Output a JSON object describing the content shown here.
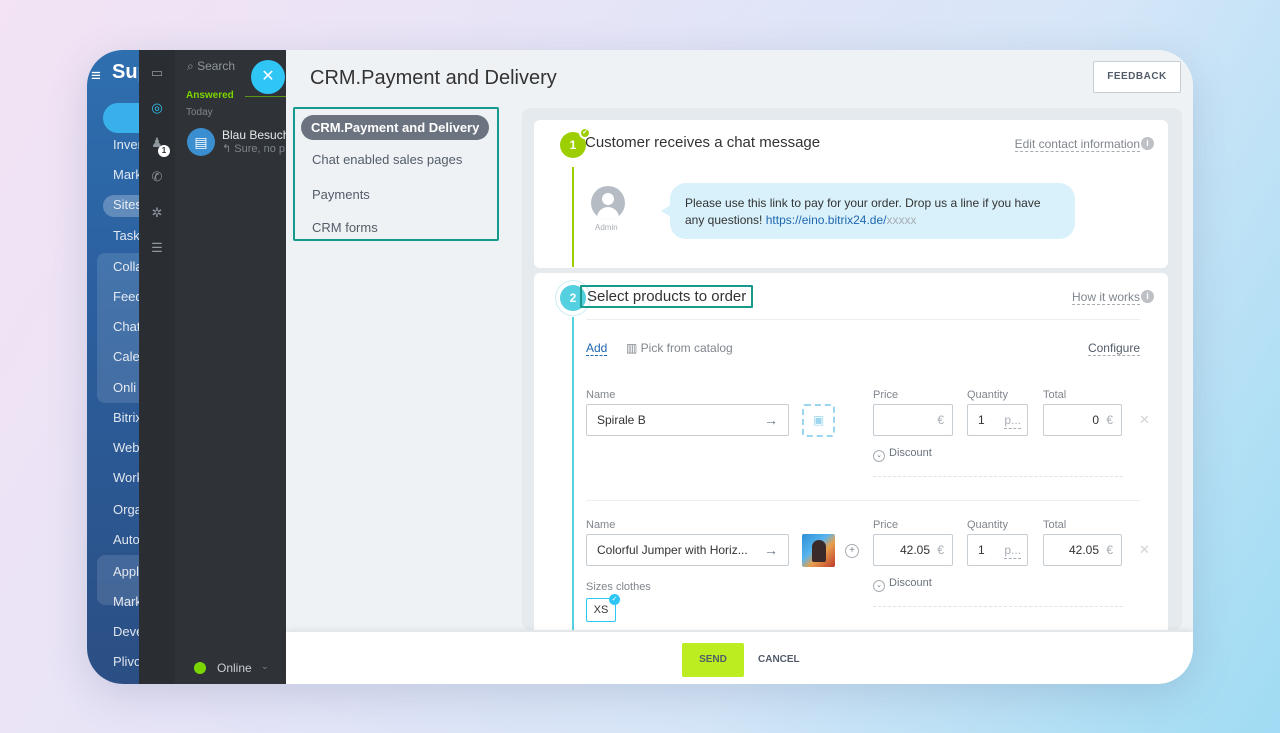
{
  "portal": {
    "logo": "Sup",
    "items": [
      "Inven",
      "Mark",
      "Sites",
      "Task",
      "Colla",
      "Feed",
      "Chat",
      "Cale",
      "Onli",
      "Bitrix",
      "Web",
      "Work",
      "Orga",
      "Auto",
      "Appl",
      "Mark",
      "Deve",
      "Plivo"
    ]
  },
  "chatlist": {
    "search_placeholder": "Search",
    "answered": "Answered",
    "today": "Today",
    "chat_name": "Blau Besuch",
    "chat_preview": "Sure, no p",
    "status": "Online"
  },
  "panel": {
    "title": "CRM.Payment and Delivery",
    "feedback": "FEEDBACK",
    "menu": [
      {
        "label": "CRM.Payment and Delivery",
        "active": true
      },
      {
        "label": "Chat enabled sales pages",
        "active": false
      },
      {
        "label": "Payments",
        "active": false
      },
      {
        "label": "CRM forms",
        "active": false
      }
    ]
  },
  "step1": {
    "number": "1",
    "title": "Customer receives a chat message",
    "link": "Edit contact information",
    "avatar_label": "Admin",
    "message": "Please use this link to pay for your order. Drop us a line if you have any questions!",
    "message_link": "https://eino.bitrix24.de/",
    "message_link_mask": "xxxxx"
  },
  "step2": {
    "number": "2",
    "title": "Select products to order",
    "link": "How it works",
    "add": "Add",
    "catalog": "Pick from catalog",
    "configure": "Configure",
    "labels": {
      "name": "Name",
      "price": "Price",
      "quantity": "Quantity",
      "total": "Total"
    },
    "discount_label": "Discount",
    "products": [
      {
        "name": "Spirale B",
        "price": "",
        "currency": "€",
        "quantity": "1",
        "unit": "p...",
        "total": "0"
      },
      {
        "name": "Colorful Jumper with Horiz...",
        "price": "42.05",
        "currency": "€",
        "quantity": "1",
        "unit": "p...",
        "total": "42.05",
        "property_label": "Sizes clothes",
        "property_value": "XS"
      }
    ]
  },
  "footer": {
    "send": "SEND",
    "cancel": "CANCEL"
  },
  "colors": {
    "accent": "#2fc6f6",
    "send": "#bbed21",
    "highlight": "#159a8b",
    "step1": "#9dcf00"
  }
}
